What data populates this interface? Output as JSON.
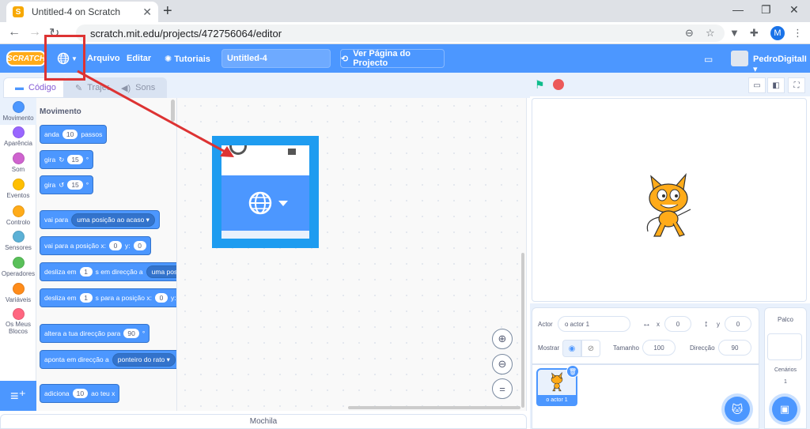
{
  "browser": {
    "tab_title": "Untitled-4 on Scratch",
    "url": "scratch.mit.edu/projects/472756064/editor",
    "profile_initial": "M"
  },
  "menubar": {
    "logo": "SCRATCH",
    "file": "Arquivo",
    "edit": "Editar",
    "tutorials": "Tutoriais",
    "project_title": "Untitled-4",
    "see_project": "Ver Página do Projecto",
    "username": "PedroDigitalI"
  },
  "editor_tabs": {
    "code": "Código",
    "costumes": "Trajes",
    "sounds": "Sons"
  },
  "categories": [
    {
      "label": "Movimento",
      "color": "#4c97ff"
    },
    {
      "label": "Aparência",
      "color": "#9966ff"
    },
    {
      "label": "Som",
      "color": "#cf63cf"
    },
    {
      "label": "Eventos",
      "color": "#ffbf00"
    },
    {
      "label": "Controlo",
      "color": "#ffab19"
    },
    {
      "label": "Sensores",
      "color": "#5cb1d6"
    },
    {
      "label": "Operadores",
      "color": "#59c059"
    },
    {
      "label": "Variáveis",
      "color": "#ff8c1a"
    },
    {
      "label": "Os Meus Blocos",
      "color": "#ff6680"
    }
  ],
  "palette": {
    "title": "Movimento",
    "move": {
      "a": "anda",
      "v": "10",
      "b": "passos"
    },
    "turn_right": {
      "a": "gira",
      "v": "15",
      "b": "°"
    },
    "turn_left": {
      "a": "gira",
      "v": "15",
      "b": "°"
    },
    "goto": {
      "a": "vai para",
      "dd": "uma posição ao acaso"
    },
    "goto_xy": {
      "a": "vai para a posição x:",
      "x": "0",
      "b": "y:",
      "y": "0"
    },
    "glide_to": {
      "a": "desliza em",
      "v": "1",
      "b": "s em direcção a",
      "dd": "uma posição"
    },
    "glide_xy": {
      "a": "desliza em",
      "v": "1",
      "b": "s para a posição x:",
      "x": "0",
      "c": "y:"
    },
    "point_dir": {
      "a": "altera a tua direcção para",
      "v": "90",
      "b": "°"
    },
    "point_towards": {
      "a": "aponta em direcção a",
      "dd": "ponteiro do rato"
    },
    "change_x": {
      "a": "adiciona",
      "v": "10",
      "b": "ao teu x"
    }
  },
  "backpack": "Mochila",
  "sprite_info": {
    "sprite_label": "Actor",
    "sprite_name": "o actor 1",
    "x_label": "x",
    "x": "0",
    "y_label": "y",
    "y": "0",
    "show_label": "Mostrar",
    "size_label": "Tamanho",
    "size": "100",
    "direction_label": "Direcção",
    "direction": "90"
  },
  "sprite_tile": "o actor 1",
  "stage_pane": {
    "title": "Palco",
    "backdrops": "Cenários",
    "count": "1"
  }
}
